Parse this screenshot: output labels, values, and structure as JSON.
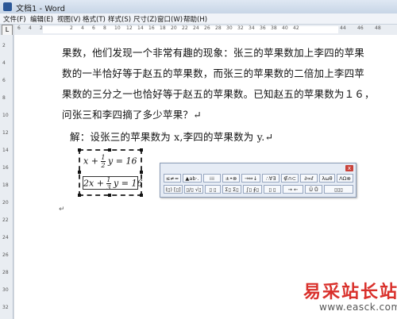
{
  "window": {
    "title": "文档1 - Word"
  },
  "menu": [
    {
      "label": "文件(F)"
    },
    {
      "label": "编辑(E)"
    },
    {
      "label": "视图(V)"
    },
    {
      "label": "格式(T)"
    },
    {
      "label": "样式(S)"
    },
    {
      "label": "尺寸(Z)"
    },
    {
      "label": "窗口(W)"
    },
    {
      "label": "帮助(H)"
    }
  ],
  "ruler_numbers": [
    "6",
    "4",
    "2",
    "2",
    "4",
    "6",
    "8",
    "10",
    "12",
    "14",
    "16",
    "18",
    "20",
    "22",
    "24",
    "26",
    "28",
    "30",
    "32",
    "34",
    "36",
    "38",
    "40",
    "42",
    "44",
    "46",
    "48"
  ],
  "vruler_numbers": [
    "2",
    "4",
    "6",
    "8",
    "10",
    "12",
    "14",
    "16",
    "18",
    "20",
    "22",
    "24",
    "26",
    "28",
    "30",
    "32"
  ],
  "document": {
    "lines": [
      "果数，他们发现一个非常有趣的现象：张三的苹果数加上李四的苹果",
      "数的一半恰好等于赵五的苹果数，而张三的苹果数的二倍加上李四苹",
      "果数的三分之一也恰好等于赵五的苹果数。已知赵五的苹果数为１６，",
      "问张三和李四摘了多少苹果？↵"
    ],
    "solution": "解：设张三的苹果数为 x,李四的苹果数为 y.↵",
    "equation1": {
      "left": "x + ",
      "num": "1",
      "den": "2",
      "right": "y = 16"
    },
    "equation2": {
      "left": "2x + ",
      "num": "1",
      "den": "3",
      "right": "y = 16"
    },
    "para_mark": "↵"
  },
  "equation_toolbar": {
    "close_label": "x",
    "row1": [
      "≤≠≈",
      "▲ab·.",
      "⁞⁞⁞",
      "±•⊗",
      "→⇔↓",
      "∴∀∃",
      "∉∩⊂",
      "∂∞ℓ",
      "λωθ",
      "ΛΩ⊗"
    ],
    "row2": [
      "(▯) [▯]",
      "▯/▯ √▯",
      "▯ ▯",
      "Σ▯ Σ▯",
      "∫▯ ∮▯",
      "▯ ▯",
      "→ ←",
      "Ū Ů",
      "▯▯▯"
    ]
  },
  "watermark": {
    "cn": "易采站长站",
    "url": "www.easck.com"
  }
}
